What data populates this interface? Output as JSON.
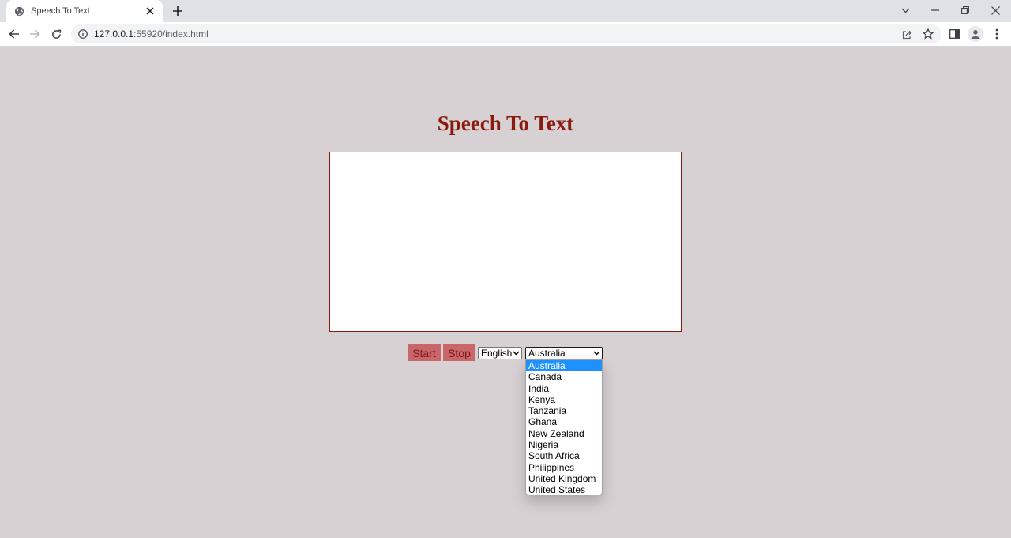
{
  "browser": {
    "tab_title": "Speech To Text",
    "url_host": "127.0.0.1",
    "url_path": ":55920/index.html"
  },
  "page": {
    "title": "Speech To Text",
    "transcript_text": "",
    "start_label": "Start",
    "stop_label": "Stop",
    "language_select": {
      "selected": "English"
    },
    "country_select": {
      "selected": "Australia",
      "open": true,
      "options": [
        "Australia",
        "Canada",
        "India",
        "Kenya",
        "Tanzania",
        "Ghana",
        "New Zealand",
        "Nigeria",
        "South Africa",
        "Philippines",
        "United Kingdom",
        "United States"
      ]
    }
  },
  "colors": {
    "page_background": "#d8d1d4",
    "title_color": "#8b1a0e",
    "button_background": "#c9666a",
    "highlight": "#1e90ff"
  }
}
